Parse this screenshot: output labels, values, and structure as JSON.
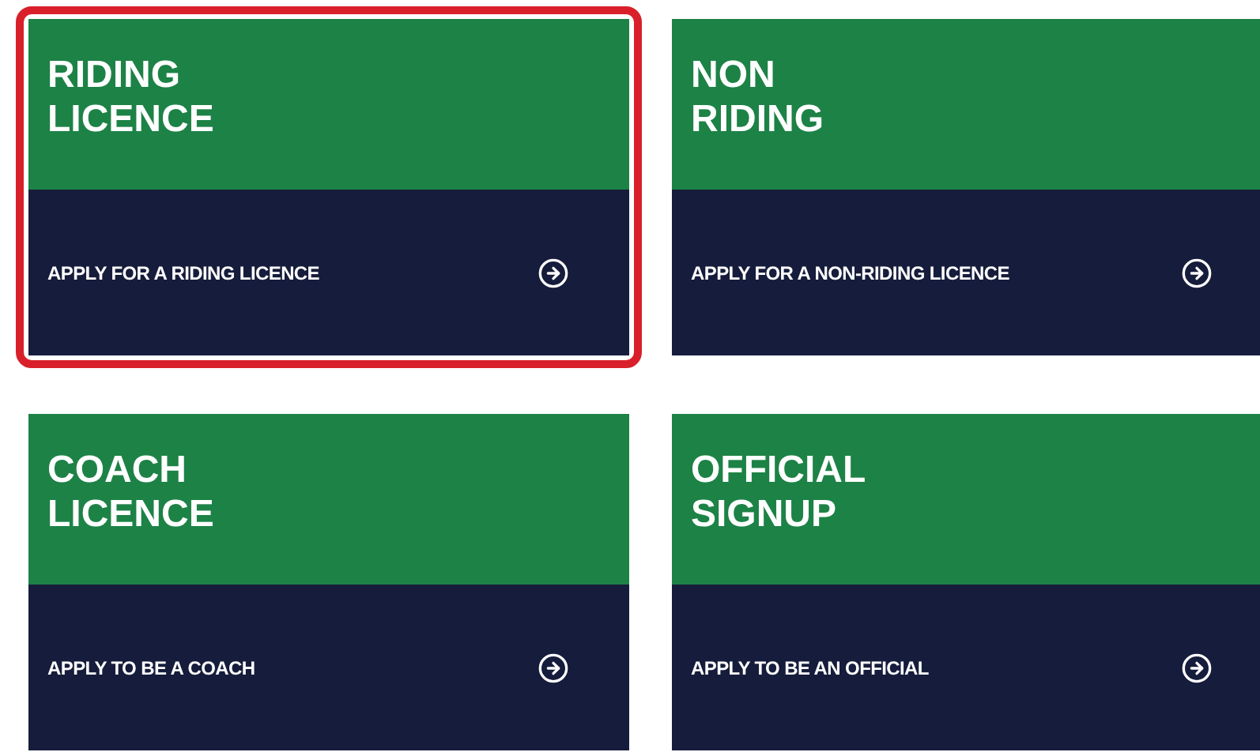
{
  "cards": [
    {
      "title": "RIDING LICENCE",
      "action": "APPLY FOR A RIDING LICENCE",
      "selected": true
    },
    {
      "title": "NON RIDING",
      "action": "APPLY FOR A NON-RIDING LICENCE",
      "selected": false
    },
    {
      "title": "COACH LICENCE",
      "action": "APPLY TO BE A COACH",
      "selected": false
    },
    {
      "title": "OFFICIAL SIGNUP",
      "action": "APPLY TO BE AN OFFICIAL",
      "selected": false
    }
  ]
}
